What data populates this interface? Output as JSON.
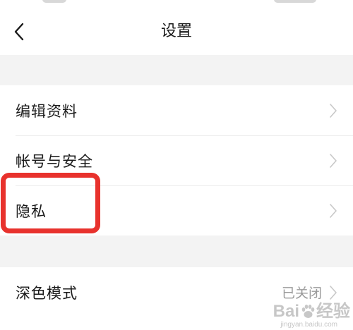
{
  "header": {
    "title": "设置",
    "back_icon": "chevron-left-icon"
  },
  "groups": [
    {
      "rows": [
        {
          "label": "编辑资料",
          "icon": "chevron-right-icon"
        },
        {
          "label": "帐号与安全",
          "icon": "chevron-right-icon"
        },
        {
          "label": "隐私",
          "icon": "chevron-right-icon",
          "highlighted": true
        }
      ]
    },
    {
      "rows": [
        {
          "label": "深色模式",
          "value": "已关闭",
          "icon": "chevron-right-icon"
        }
      ]
    }
  ],
  "watermark": {
    "brand_left": "Bai",
    "brand_right": "经验",
    "url": "jingyan.baidu.com"
  },
  "colors": {
    "background": "#ffffff",
    "section_gap": "#f3f3f3",
    "divider": "#ececec",
    "chevron": "#c8c8c8",
    "secondary_text": "#9a9a9a",
    "highlight_border": "#e8322d"
  }
}
